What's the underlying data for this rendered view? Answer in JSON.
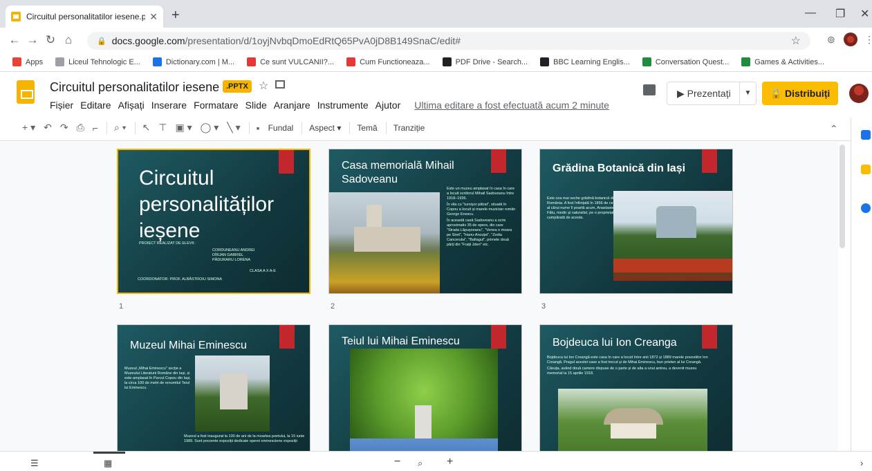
{
  "browser": {
    "tab_title": "Circuitul personalitatilor iesene.p",
    "url_host": "docs.google.com",
    "url_path": "/presentation/d/1oyjNvbqDmoEdRtQ65PvA0jD8B149SnaC/edit#",
    "bookmarks": [
      {
        "label": "Apps",
        "color": "#ea4335"
      },
      {
        "label": "Liceul Tehnologic E...",
        "color": "#9aa0a6"
      },
      {
        "label": "Dictionary.com | M...",
        "color": "#1a73e8"
      },
      {
        "label": "Ce sunt VULCANII?...",
        "color": "#e53935"
      },
      {
        "label": "Cum Functioneaza...",
        "color": "#e53935"
      },
      {
        "label": "PDF Drive - Search...",
        "color": "#202124"
      },
      {
        "label": "BBC Learning Englis...",
        "color": "#202124"
      },
      {
        "label": "Conversation Quest...",
        "color": "#1e8e3e"
      },
      {
        "label": "Games & Activities...",
        "color": "#1e8e3e"
      }
    ]
  },
  "app": {
    "doc_title": "Circuitul personalitatilor iesene",
    "badge": ".PPTX",
    "menu": [
      "Fișier",
      "Editare",
      "Afișați",
      "Inserare",
      "Formatare",
      "Slide",
      "Aranjare",
      "Instrumente",
      "Ajutor"
    ],
    "last_edit": "Ultima editare a fost efectuată acum 2 minute",
    "present_label": "Prezentați",
    "share_label": "Distribuiți",
    "toolbar_text": [
      "Fundal",
      "Aspect",
      "Temă",
      "Tranziție"
    ]
  },
  "slides": [
    {
      "num": "1",
      "title": "Circuitul personalităților ieșene",
      "line1": "PROIECT REALIZAT DE ELEVII:",
      "students": "CORDUNEANU ANDREI\nDÎRJAN GABRIEL\nPĂDURARU LORENA",
      "class": "CLASA A X A-E",
      "coord": "COORDONATOR: PROF. ALBĂSTROIU SIMONA"
    },
    {
      "num": "2",
      "title": "Casa memorială Mihail Sadoveanu",
      "bullets": [
        "Este un muzeu amplasat în casa în care a locuit scriitorul Mihail Sadoveanu între 1918–1936.",
        "În vila cu \"turnișor pătrat\", situată în Copou a locuit și marele muzician român George Enescu.",
        "În această casă Sadoveanu a scris aproximativ 35 de opere, din care \"Strada Lăpușneanu\", \"Venea o moara pe Siret\", \"Hanu-Ancuței\", \"Zodia Cancerului\", \"Baltagul\", primele două părți din \"Frații Jderi\" etc."
      ]
    },
    {
      "num": "3",
      "title": "Grădina Botanică din Iași",
      "bullets": [
        "Este cea mai veche grădină botanică din România. A fost înființată în 1856 de cel al cărui nume îl poartă acum, Anastasie Fătu, medic și naturalist, pe o proprietate cumpărată de acesta."
      ]
    },
    {
      "num": "",
      "title": "Muzeul Mihai Eminescu",
      "bullets": [
        "Muzeul „Mihai Eminescu\" secție a Muzeului Literaturii Române din Iași, și este amplasat în Parcul Copou din Iași, la circa 100 de metri de renumitul Teiul lui Eminescu.",
        "Muzeul a fost inaugurat la 100 de ani de la moartea poetului, la 15 iunie 1989. Sunt prezente expoziții dedicate operei eminesciene expoziții"
      ]
    },
    {
      "num": "",
      "title": "Teiul lui Mihai Eminescu"
    },
    {
      "num": "",
      "title": "Bojdeuca lui Ion Creanga",
      "bullets": [
        "Bojdeuca lui Ion Creangă este casa în care a locuit între anii 1872 și 1889 marele povestitor Ion Creangă. Pragul acestei case a fost trecut și de Mihai Eminescu, bun prieten al lui Creangă.",
        "Căsuța, având două camere dispuse de o parte și de alta a unui antreu, a devenit muzeu memorial la 15 aprilie 1918."
      ]
    }
  ],
  "colors": {
    "accent": "#f4b400",
    "ribbon": "#c1272d",
    "slide_bg": "#1f5a63"
  }
}
